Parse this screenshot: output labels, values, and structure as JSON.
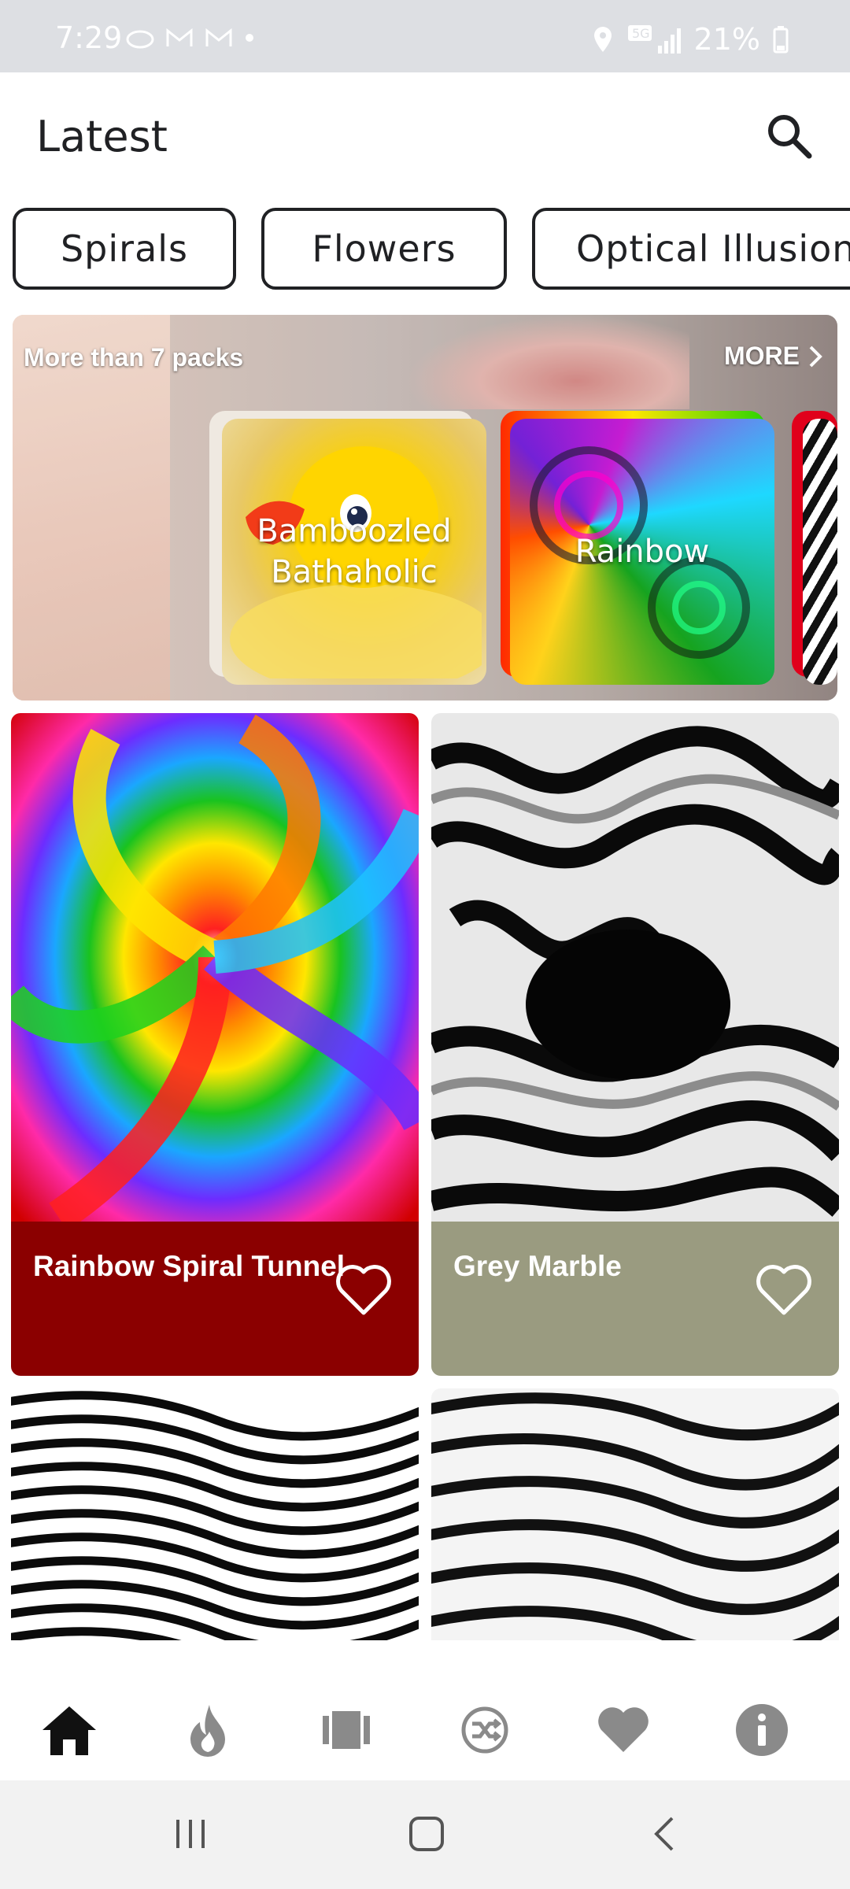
{
  "status_bar": {
    "time": "7:29",
    "battery": "21%",
    "network": "5G"
  },
  "header": {
    "title": "Latest"
  },
  "chips": [
    "Spirals",
    "Flowers",
    "Optical Illusion"
  ],
  "banner": {
    "caption": "More than 7 packs",
    "more_label": "MORE",
    "packs": [
      "Bamboozled\nBathaholic",
      "Rainbow"
    ]
  },
  "cards": [
    {
      "title": "Rainbow Spiral Tunnel",
      "bar_color": "#8b0000"
    },
    {
      "title": "Grey Marble",
      "bar_color": "#9a9b80"
    }
  ],
  "bottom_nav": [
    "home-icon",
    "flame-icon",
    "packs-icon",
    "shuffle-icon",
    "heart-icon",
    "info-icon"
  ],
  "colors": {
    "accent": "#202124",
    "status_bar": "#dddfe3"
  }
}
